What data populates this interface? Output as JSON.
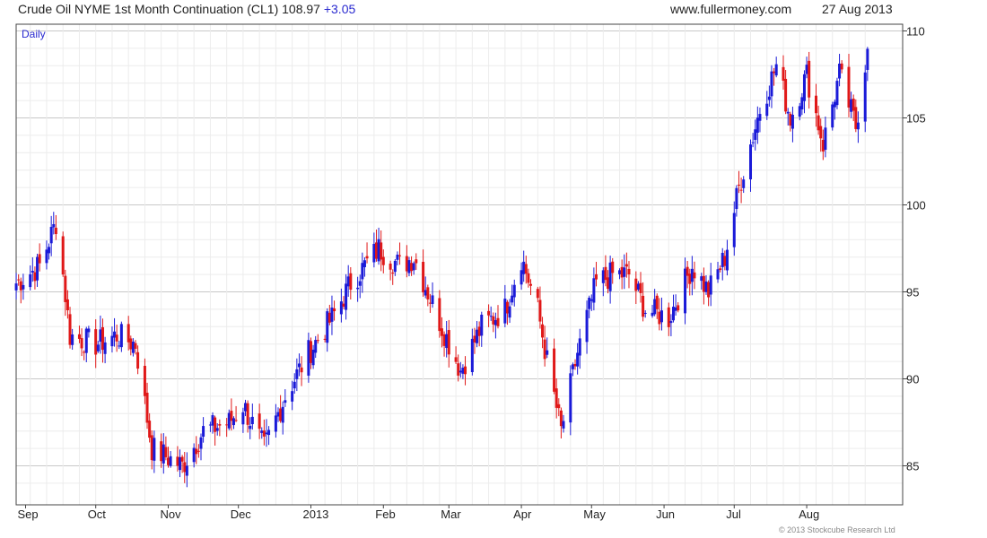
{
  "header": {
    "title_prefix": "Crude Oil NYME 1st Month Continuation (CL1) 108.97",
    "change": "+3.05",
    "change_color": "#2a2ad0",
    "website": "www.fullermoney.com",
    "date": "27 Aug 2013"
  },
  "copyright": "© 2013 Stockcube Research Ltd",
  "chart_data": {
    "type": "candlestick",
    "period_label": "Daily",
    "title": "Crude Oil NYME 1st Month Continuation (CL1) 108.97 +3.05",
    "ylim": [
      83,
      110
    ],
    "y_ticks": [
      85,
      90,
      95,
      100,
      105,
      110
    ],
    "x_tick_labels": [
      "Sep",
      "Oct",
      "Nov",
      "Dec",
      "2013",
      "Feb",
      "Mar",
      "Apr",
      "May",
      "Jun",
      "Jul",
      "Aug"
    ],
    "grid": true,
    "up_color": "#1a1ad8",
    "down_color": "#e01818",
    "approx_close_path": [
      [
        "2012-08-28",
        95.5
      ],
      [
        "2012-09-07",
        96.5
      ],
      [
        "2012-09-14",
        99.0
      ],
      [
        "2012-09-17",
        96.0
      ],
      [
        "2012-09-20",
        92.5
      ],
      [
        "2012-10-01",
        92.0
      ],
      [
        "2012-10-10",
        92.5
      ],
      [
        "2012-10-18",
        92.0
      ],
      [
        "2012-10-25",
        86.0
      ],
      [
        "2012-11-07",
        85.0
      ],
      [
        "2012-11-16",
        87.0
      ],
      [
        "2012-11-27",
        87.5
      ],
      [
        "2012-12-03",
        88.5
      ],
      [
        "2012-12-12",
        86.0
      ],
      [
        "2012-12-21",
        89.0
      ],
      [
        "2012-12-31",
        91.5
      ],
      [
        "2013-01-10",
        93.5
      ],
      [
        "2013-01-18",
        95.5
      ],
      [
        "2013-01-30",
        97.5
      ],
      [
        "2013-02-08",
        96.5
      ],
      [
        "2013-02-14",
        97.0
      ],
      [
        "2013-02-26",
        93.0
      ],
      [
        "2013-03-06",
        90.5
      ],
      [
        "2013-03-15",
        93.0
      ],
      [
        "2013-03-25",
        94.0
      ],
      [
        "2013-04-01",
        97.0
      ],
      [
        "2013-04-08",
        94.0
      ],
      [
        "2013-04-12",
        91.0
      ],
      [
        "2013-04-18",
        87.0
      ],
      [
        "2013-04-25",
        91.5
      ],
      [
        "2013-05-03",
        95.5
      ],
      [
        "2013-05-10",
        96.0
      ],
      [
        "2013-05-17",
        96.0
      ],
      [
        "2013-05-24",
        94.0
      ],
      [
        "2013-06-03",
        93.5
      ],
      [
        "2013-06-13",
        96.5
      ],
      [
        "2013-06-20",
        95.0
      ],
      [
        "2013-06-27",
        97.0
      ],
      [
        "2013-07-03",
        101.0
      ],
      [
        "2013-07-12",
        105.5
      ],
      [
        "2013-07-19",
        108.0
      ],
      [
        "2013-07-25",
        105.0
      ],
      [
        "2013-08-01",
        107.5
      ],
      [
        "2013-08-08",
        103.5
      ],
      [
        "2013-08-15",
        107.5
      ],
      [
        "2013-08-22",
        104.5
      ],
      [
        "2013-08-27",
        108.97
      ]
    ]
  }
}
